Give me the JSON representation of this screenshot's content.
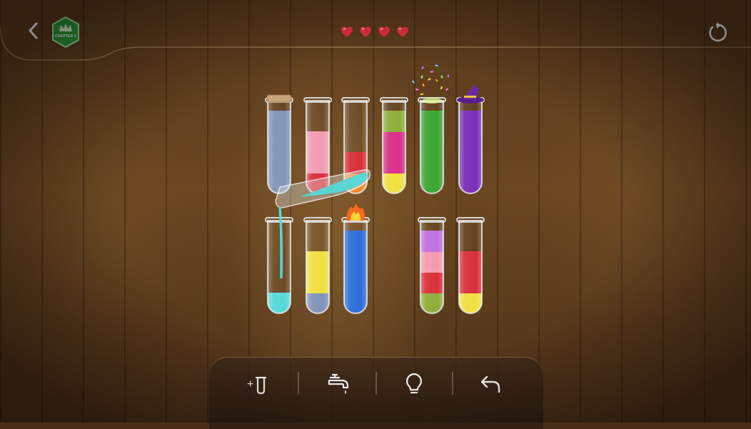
{
  "header": {
    "back_icon": "chevron-left-icon",
    "chapter_label": "CHAPTER 1",
    "hearts": 4,
    "restart_icon": "restart-icon"
  },
  "colors": {
    "badge_green": "#2e9b3a",
    "heart_red": "#e8303e",
    "glass": "#dfe6ea",
    "light_blue": "#8193b8",
    "pink": "#f29ab0",
    "red": "#d9303a",
    "orange": "#f08a2c",
    "magenta": "#d8308a",
    "yellow": "#f0e040",
    "olive": "#8fae3a",
    "green": "#3aa632",
    "purple": "#7a2fb8",
    "cyan": "#55d8d8",
    "blue": "#2d6fd8",
    "lavender": "#c070e0"
  },
  "tubes": [
    {
      "id": "tube-1",
      "row": 1,
      "capped": "cork",
      "layers": [
        "light_blue",
        "light_blue",
        "light_blue",
        "light_blue"
      ]
    },
    {
      "id": "tube-2",
      "row": 1,
      "layers": [
        "red",
        "pink",
        "pink"
      ]
    },
    {
      "id": "tube-3",
      "row": 1,
      "layers": [
        "orange",
        "red"
      ]
    },
    {
      "id": "tube-4",
      "row": 1,
      "layers": [
        "yellow",
        "magenta",
        "magenta",
        "olive"
      ]
    },
    {
      "id": "tube-5",
      "row": 1,
      "capped": "confetti",
      "layers": [
        "green",
        "green",
        "green",
        "green"
      ]
    },
    {
      "id": "tube-6",
      "row": 1,
      "capped": "witch-hat",
      "layers": [
        "purple",
        "purple",
        "purple",
        "purple"
      ]
    },
    {
      "id": "tube-7",
      "row": 2,
      "layers": [
        "cyan"
      ]
    },
    {
      "id": "tube-8",
      "row": 2,
      "layers": [
        "light_blue",
        "yellow",
        "yellow"
      ]
    },
    {
      "id": "tube-9",
      "row": 2,
      "capped": "fire",
      "layers": [
        "blue",
        "blue",
        "blue",
        "blue"
      ]
    },
    {
      "id": "tube-10",
      "row": 2,
      "layers": [
        "olive",
        "red",
        "pink",
        "lavender"
      ]
    },
    {
      "id": "tube-11",
      "row": 2,
      "layers": [
        "yellow",
        "red",
        "red"
      ]
    }
  ],
  "pouring": {
    "from_color": "cyan",
    "into": "tube-7"
  },
  "toolbar": {
    "add_tube_label": "+",
    "add_tube_icon": "add-tube-icon",
    "faucet_icon": "faucet-icon",
    "hint_icon": "lightbulb-icon",
    "undo_icon": "undo-icon"
  }
}
